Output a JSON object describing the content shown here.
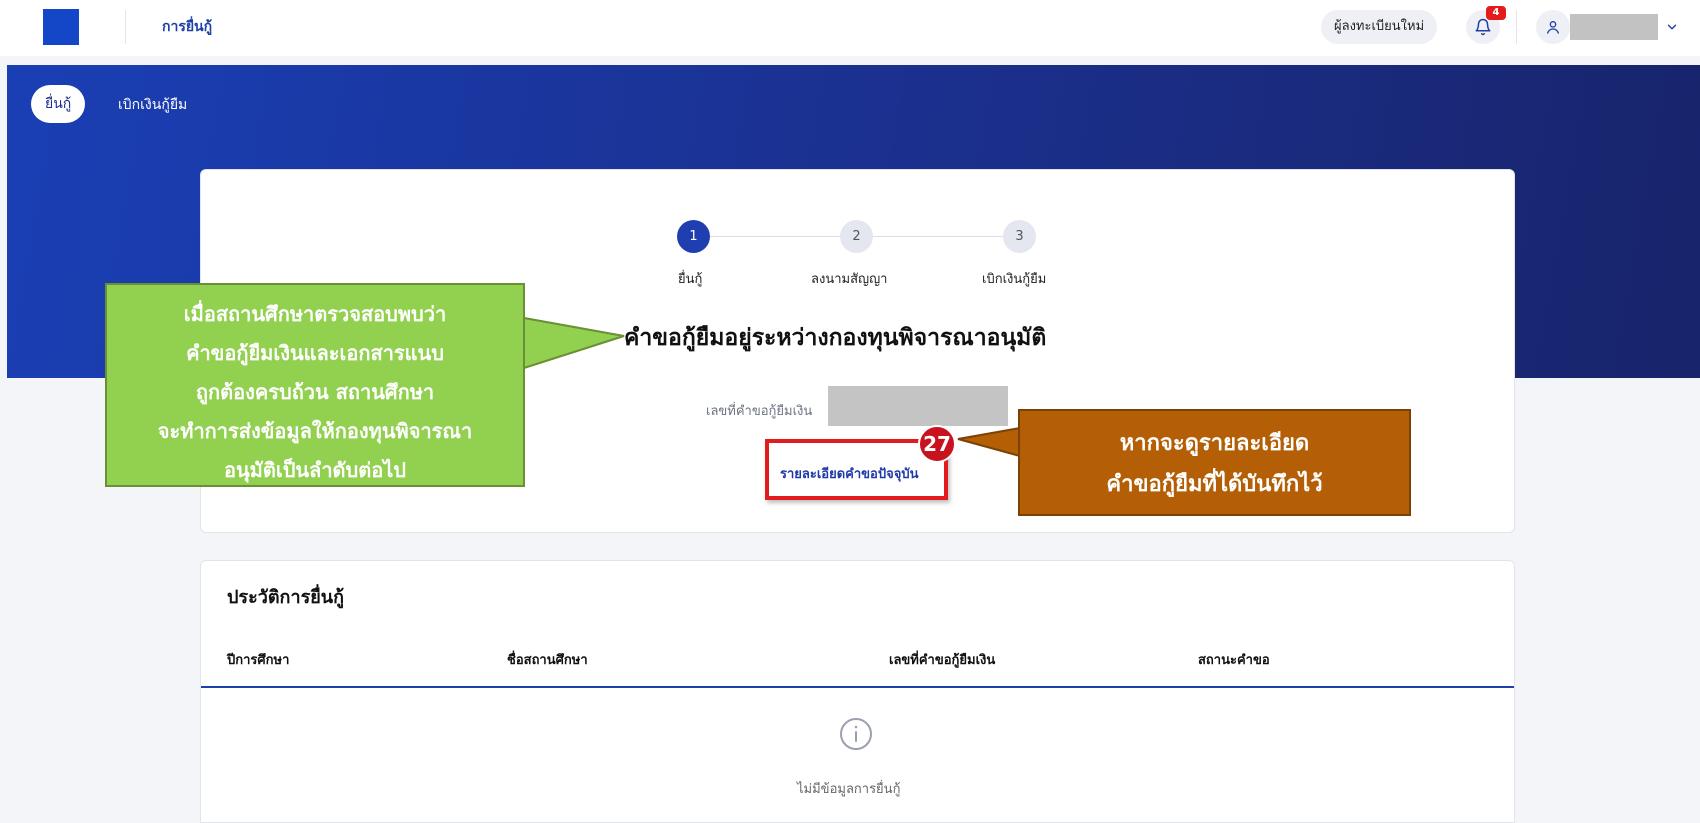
{
  "header": {
    "title": "การยื่นกู้",
    "register_label": "ผู้ลงทะเบียนใหม่",
    "notification_count": "4"
  },
  "subnav": {
    "active": "ยื่นกู้",
    "other": "เบิกเงินกู้ยืม"
  },
  "stepper": [
    {
      "number": "1",
      "label": "ยื่นกู้"
    },
    {
      "number": "2",
      "label": "ลงนามสัญญา"
    },
    {
      "number": "3",
      "label": "เบิกเงินกู้ยืม"
    }
  ],
  "status": {
    "heading": "คำขอกู้ยืมอยู่ระหว่างกองทุนพิจารณาอนุมัติ",
    "loan_no_label": "เลขที่คำขอกู้ยืมเงิน",
    "detail_link": "รายละเอียดคำขอปัจจุบัน"
  },
  "annotation": {
    "number": "27",
    "green_lines": [
      "เมื่อสถานศึกษาตรวจสอบพบว่า",
      "คำขอกู้ยืมเงินและเอกสารแนบ",
      "ถูกต้องครบถ้วน สถานศึกษา",
      "จะทำการส่งข้อมูลให้กองทุนพิจารณา",
      "อนุมัติเป็นลำดับต่อไป"
    ],
    "orange_lines": [
      "หากจะดูรายละเอียด",
      "คำขอกู้ยืมที่ได้บันทึกไว้"
    ]
  },
  "history": {
    "title": "ประวัติการยื่นกู้",
    "columns": [
      "ปีการศึกษา",
      "ชื่อสถานศึกษา",
      "เลขที่คำขอกู้ยืมเงิน",
      "สถานะคำขอ"
    ],
    "empty_text": "ไม่มีข้อมูลการยื่นกู้"
  },
  "colors": {
    "primary": "#1f3fa8",
    "callout_green": "#92d050",
    "callout_orange": "#b45f06",
    "highlight_red": "#e21c1c"
  }
}
